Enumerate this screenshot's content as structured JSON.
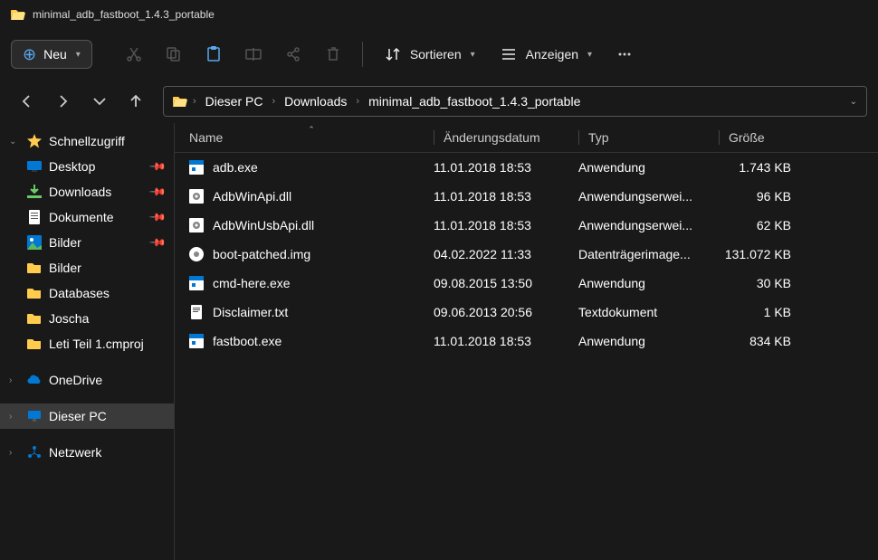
{
  "title": "minimal_adb_fastboot_1.4.3_portable",
  "toolbar": {
    "new_label": "Neu",
    "sort_label": "Sortieren",
    "view_label": "Anzeigen"
  },
  "breadcrumb": [
    "Dieser PC",
    "Downloads",
    "minimal_adb_fastboot_1.4.3_portable"
  ],
  "columns": {
    "name": "Name",
    "date": "Änderungsdatum",
    "type": "Typ",
    "size": "Größe"
  },
  "sidebar": {
    "quick_access": "Schnellzugriff",
    "items_pinned": [
      {
        "label": "Desktop",
        "icon": "desktop"
      },
      {
        "label": "Downloads",
        "icon": "download"
      },
      {
        "label": "Dokumente",
        "icon": "document"
      },
      {
        "label": "Bilder",
        "icon": "picture"
      }
    ],
    "items_recent": [
      {
        "label": "Bilder",
        "icon": "folder"
      },
      {
        "label": "Databases",
        "icon": "folder"
      },
      {
        "label": "Joscha",
        "icon": "folder"
      },
      {
        "label": "Leti Teil 1.cmproj",
        "icon": "folder"
      }
    ],
    "onedrive": "OneDrive",
    "this_pc": "Dieser PC",
    "network": "Netzwerk"
  },
  "files": [
    {
      "name": "adb.exe",
      "date": "11.01.2018 18:53",
      "type": "Anwendung",
      "size": "1.743 KB",
      "icon": "exe"
    },
    {
      "name": "AdbWinApi.dll",
      "date": "11.01.2018 18:53",
      "type": "Anwendungserwei...",
      "size": "96 KB",
      "icon": "dll"
    },
    {
      "name": "AdbWinUsbApi.dll",
      "date": "11.01.2018 18:53",
      "type": "Anwendungserwei...",
      "size": "62 KB",
      "icon": "dll"
    },
    {
      "name": "boot-patched.img",
      "date": "04.02.2022 11:33",
      "type": "Datenträgerimage...",
      "size": "131.072 KB",
      "icon": "img"
    },
    {
      "name": "cmd-here.exe",
      "date": "09.08.2015 13:50",
      "type": "Anwendung",
      "size": "30 KB",
      "icon": "exe"
    },
    {
      "name": "Disclaimer.txt",
      "date": "09.06.2013 20:56",
      "type": "Textdokument",
      "size": "1 KB",
      "icon": "txt"
    },
    {
      "name": "fastboot.exe",
      "date": "11.01.2018 18:53",
      "type": "Anwendung",
      "size": "834 KB",
      "icon": "exe"
    }
  ]
}
